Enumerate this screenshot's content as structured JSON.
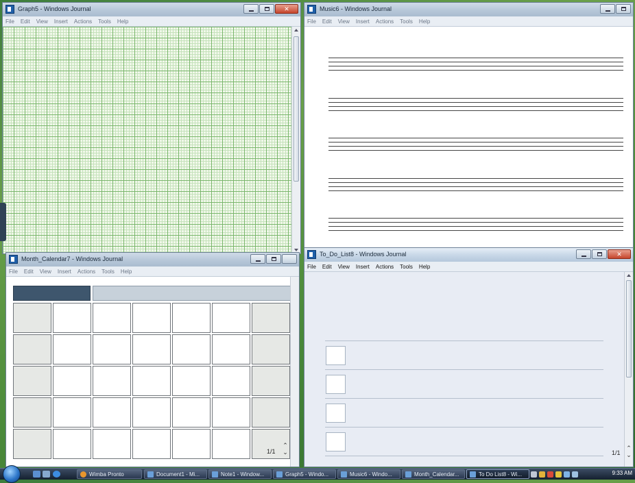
{
  "colors": {
    "accent": "#1f5fa8",
    "grid_major": "#79b66b",
    "grid_minor": "#c5e2bb",
    "calendar_header": "#3e566d"
  },
  "menu": [
    "File",
    "Edit",
    "View",
    "Insert",
    "Actions",
    "Tools",
    "Help"
  ],
  "windows": {
    "graph": {
      "title": "Graph5 - Windows Journal"
    },
    "music": {
      "title": "Music6 - Windows Journal"
    },
    "calendar": {
      "title": "Month_Calendar7 - Windows Journal",
      "page": "1/1"
    },
    "todo": {
      "title": "To_Do_List8 - Windows Journal",
      "page": "1/1"
    }
  },
  "taskbar": {
    "buttons": [
      {
        "label": "Wimba Pronto"
      },
      {
        "label": "Document1 - Mi..."
      },
      {
        "label": "Note1 - Window..."
      },
      {
        "label": "Graph5 - Windo..."
      },
      {
        "label": "Music6 - Windo..."
      },
      {
        "label": "Month_Calendar..."
      },
      {
        "label": "To Do List8 - Wi..."
      }
    ],
    "clock": "9:33 AM"
  }
}
